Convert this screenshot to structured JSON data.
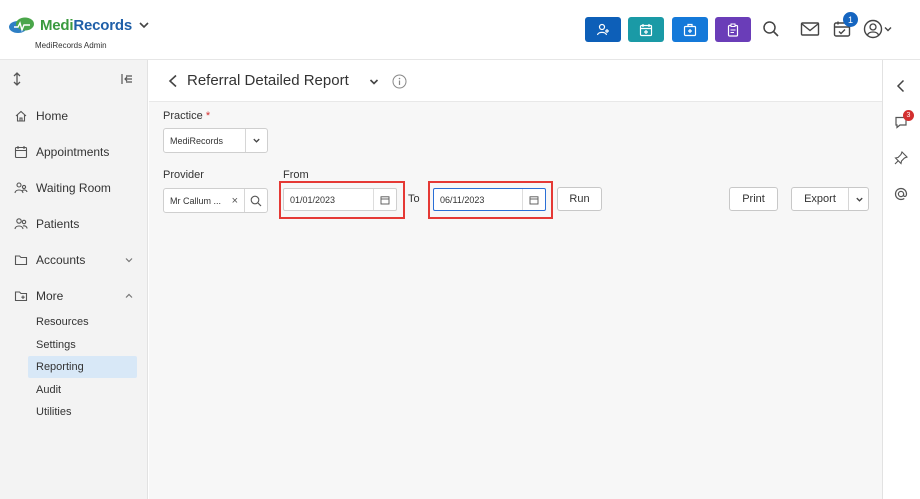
{
  "brand": {
    "name_part1": "Medi",
    "name_part2": "Records",
    "subtitle": "MediRecords Admin"
  },
  "topbar": {
    "quick_actions": [
      {
        "icon": "add-person-icon",
        "color": "#0d5fb8"
      },
      {
        "icon": "calendar-add-icon",
        "color": "#1a9aa6"
      },
      {
        "icon": "medical-case-icon",
        "color": "#1479d9"
      },
      {
        "icon": "clipboard-icon",
        "color": "#6a3db8"
      }
    ],
    "notification_count": "1"
  },
  "sidebar": {
    "items": [
      {
        "label": "Home",
        "icon": "home-icon"
      },
      {
        "label": "Appointments",
        "icon": "calendar-icon"
      },
      {
        "label": "Waiting Room",
        "icon": "waiting-room-icon"
      },
      {
        "label": "Patients",
        "icon": "patients-icon"
      },
      {
        "label": "Accounts",
        "icon": "folder-icon"
      },
      {
        "label": "More",
        "icon": "folder-plus-icon"
      }
    ],
    "sub_items": [
      "Resources",
      "Settings",
      "Reporting",
      "Audit",
      "Utilities"
    ]
  },
  "report": {
    "title": "Referral Detailed Report",
    "practice_label": "Practice",
    "practice_required": "*",
    "practice_value": "MediRecords",
    "provider_label": "Provider",
    "provider_value": "Mr Callum ...",
    "provider_clear": "×",
    "from_label": "From",
    "from_value": "01/01/2023",
    "to_label": "To",
    "to_value": "06/11/2023",
    "run_label": "Run",
    "print_label": "Print",
    "export_label": "Export"
  },
  "rail": {
    "chat_badge": "3"
  }
}
